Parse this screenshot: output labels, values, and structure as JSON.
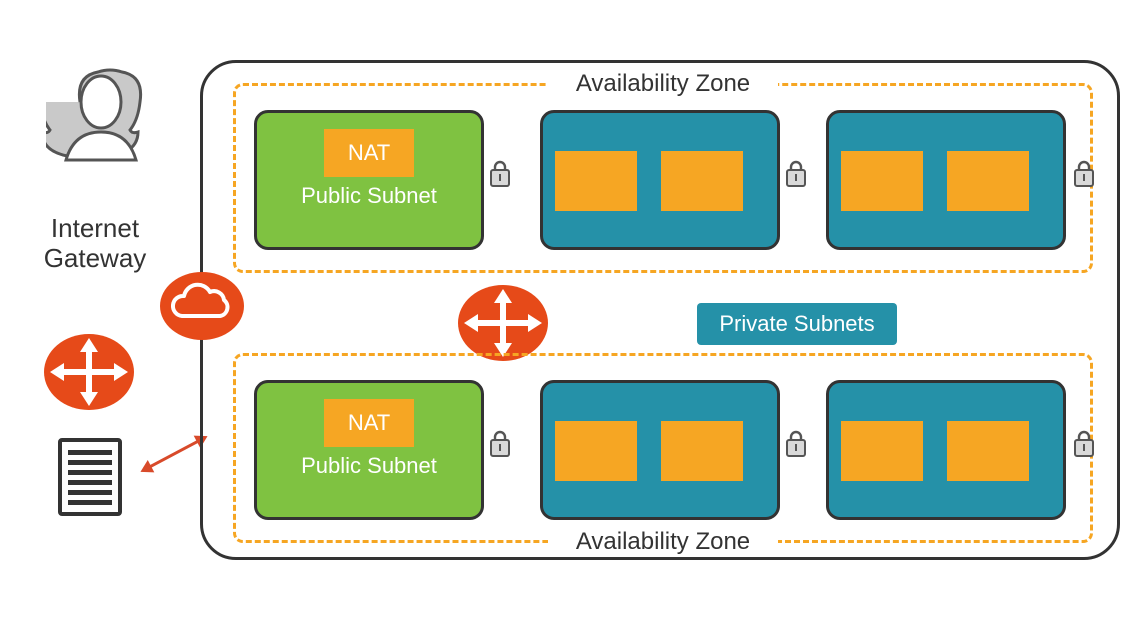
{
  "labels": {
    "availability_zone": "Availability Zone",
    "nat": "NAT",
    "public_subnet": "Public Subnet",
    "private_subnets": "Private Subnets",
    "internet_gateway_line1": "Internet",
    "internet_gateway_line2": "Gateway"
  },
  "icons": {
    "user": "user-icon",
    "cloud": "cloud-icon",
    "routing": "routing-icon",
    "server": "server-icon",
    "lock": "lock-icon",
    "double_arrow": "double-arrow-icon"
  },
  "colors": {
    "accent_orange": "#f6a623",
    "accent_green": "#7fc241",
    "accent_teal": "#2591a8",
    "accent_red_orange": "#e64a19",
    "stroke": "#333333",
    "user_gray": "#c9c9c9"
  },
  "structure": {
    "vpc": {
      "availability_zones": [
        {
          "position": "top",
          "public_subnet": {
            "nat": true
          },
          "private_subnets": [
            {
              "blocks": 2
            },
            {
              "blocks": 2
            }
          ]
        },
        {
          "position": "bottom",
          "public_subnet": {
            "nat": true
          },
          "private_subnets": [
            {
              "blocks": 2
            },
            {
              "blocks": 2
            }
          ]
        }
      ],
      "internet_gateway": true,
      "route_table": "center"
    },
    "external": {
      "user": true,
      "router": true,
      "server": true,
      "link_router_to_igw": true
    }
  }
}
